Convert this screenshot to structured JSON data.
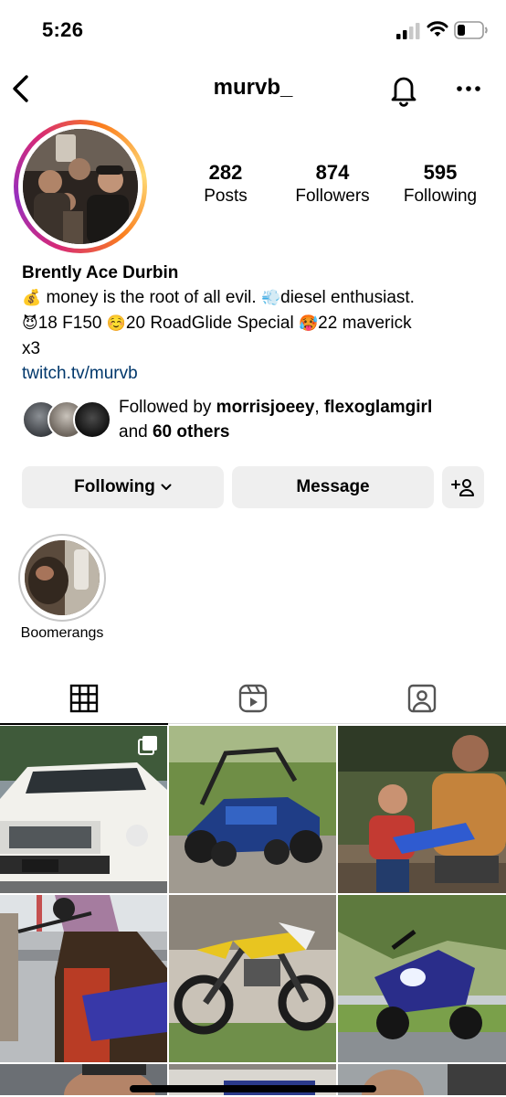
{
  "status_bar": {
    "time": "5:26"
  },
  "nav": {
    "username": "murvb_"
  },
  "profile": {
    "stats": [
      {
        "value": "282",
        "label": "Posts"
      },
      {
        "value": "874",
        "label": "Followers"
      },
      {
        "value": "595",
        "label": "Following"
      }
    ],
    "name": "Brently Ace Durbin",
    "bio": {
      "line1_emoji": "💰",
      "line1_text": " money is the root of all evil. ",
      "line1_emoji2": "💨",
      "line1_text2": "diesel enthusiast.",
      "line2_emoji1": "😈",
      "line2_text1": "18 F150 ",
      "line2_emoji2": "☺️",
      "line2_text2": "20 RoadGlide Special ",
      "line2_emoji3": "🥵",
      "line2_text3": "22 maverick",
      "line3": "x3"
    },
    "link": "twitch.tv/murvb",
    "followed_by": {
      "prefix": "Followed by ",
      "user1": "morrisjoeey",
      "sep": ", ",
      "user2": "flexoglamgirl",
      "and": "and ",
      "others": "60 others"
    }
  },
  "actions": {
    "following_label": "Following",
    "message_label": "Message"
  },
  "highlights": [
    {
      "label": "Boomerangs"
    }
  ],
  "tabs": [
    {
      "icon": "grid-icon",
      "active": true
    },
    {
      "icon": "reels-icon",
      "active": false
    },
    {
      "icon": "tagged-icon",
      "active": false
    }
  ],
  "colors": {
    "link": "#00376b",
    "button_bg": "#efefef"
  }
}
